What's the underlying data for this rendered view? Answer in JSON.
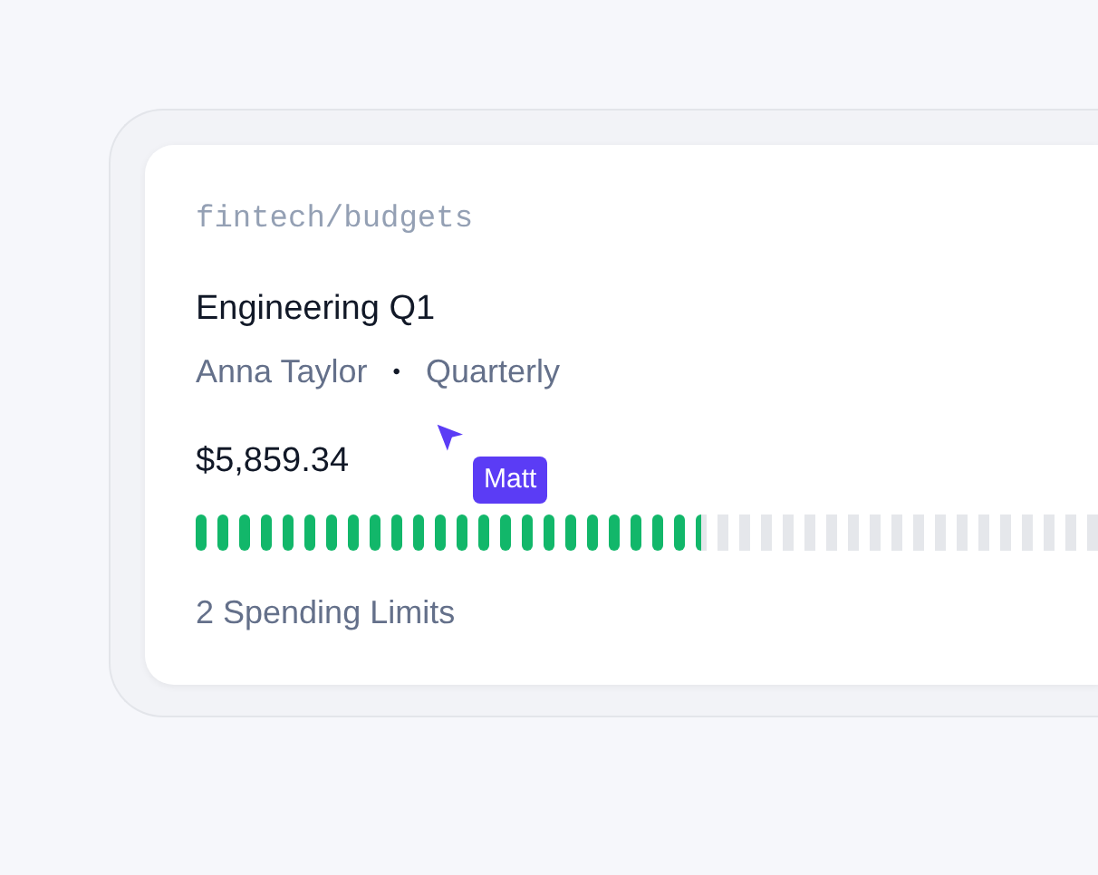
{
  "card": {
    "path": "fintech/budgets",
    "title": "Engineering Q1",
    "owner": "Anna Taylor",
    "separator": "•",
    "period": "Quarterly",
    "amount": "$5,859.34",
    "meter": {
      "level": 0.56
    },
    "footer": "2 Spending Limits"
  },
  "cursor": {
    "label": "Matt"
  }
}
